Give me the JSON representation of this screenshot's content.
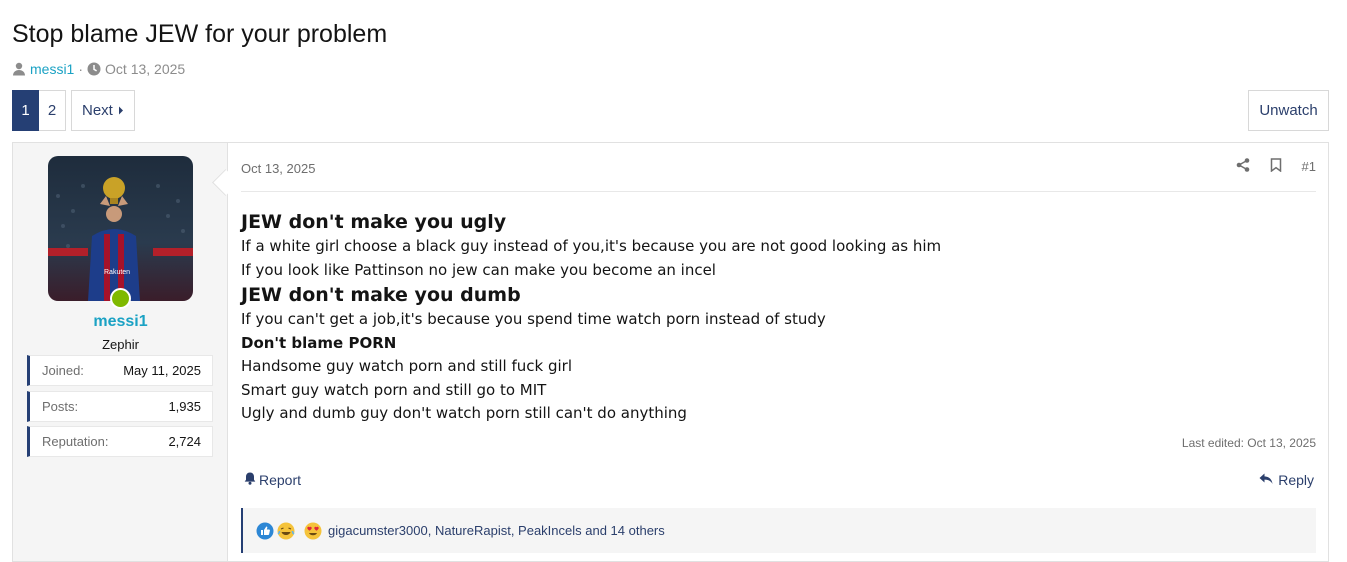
{
  "thread": {
    "title": "Stop blame JEW for your problem",
    "author": "messi1",
    "separator": "·",
    "date": "Oct 13, 2025"
  },
  "pager": {
    "pages": [
      "1",
      "2"
    ],
    "current": "1",
    "next_label": "Next"
  },
  "watch_label": "Unwatch",
  "post": {
    "date": "Oct 13, 2025",
    "number": "#1",
    "user": {
      "name": "messi1",
      "title": "Zephir",
      "stats": [
        {
          "key": "Joined:",
          "value": "May 11, 2025"
        },
        {
          "key": "Posts:",
          "value": "1,935"
        },
        {
          "key": "Reputation:",
          "value": "2,724"
        }
      ]
    },
    "content": {
      "heading1": "JEW don't make you ugly",
      "line1": "If a white girl choose a black guy instead of you,it's because you are not good looking as him",
      "line2": "If you look like Pattinson no jew can make you become an incel",
      "heading2": "JEW don't make you dumb",
      "line3": "If you can't get a job,it's because you spend time watch porn instead of study",
      "bold_line": "Don't blame PORN",
      "line4": "Handsome guy watch porn and still fuck girl",
      "line5": "Smart guy watch porn and still go to MIT",
      "line6": "Ugly and dumb guy don't watch porn still can't do anything"
    },
    "last_edited": "Last edited: Oct 13, 2025",
    "report_label": "Report",
    "reply_label": "Reply",
    "reactions_text": "gigacumster3000, NatureRapist, PeakIncels and 14 others",
    "reaction_icons": [
      "like-icon",
      "laugh-icon",
      "love-eyes-icon"
    ]
  },
  "colors": {
    "accent": "#253f74",
    "link": "#1ba2c4",
    "online": "#7fb900"
  }
}
